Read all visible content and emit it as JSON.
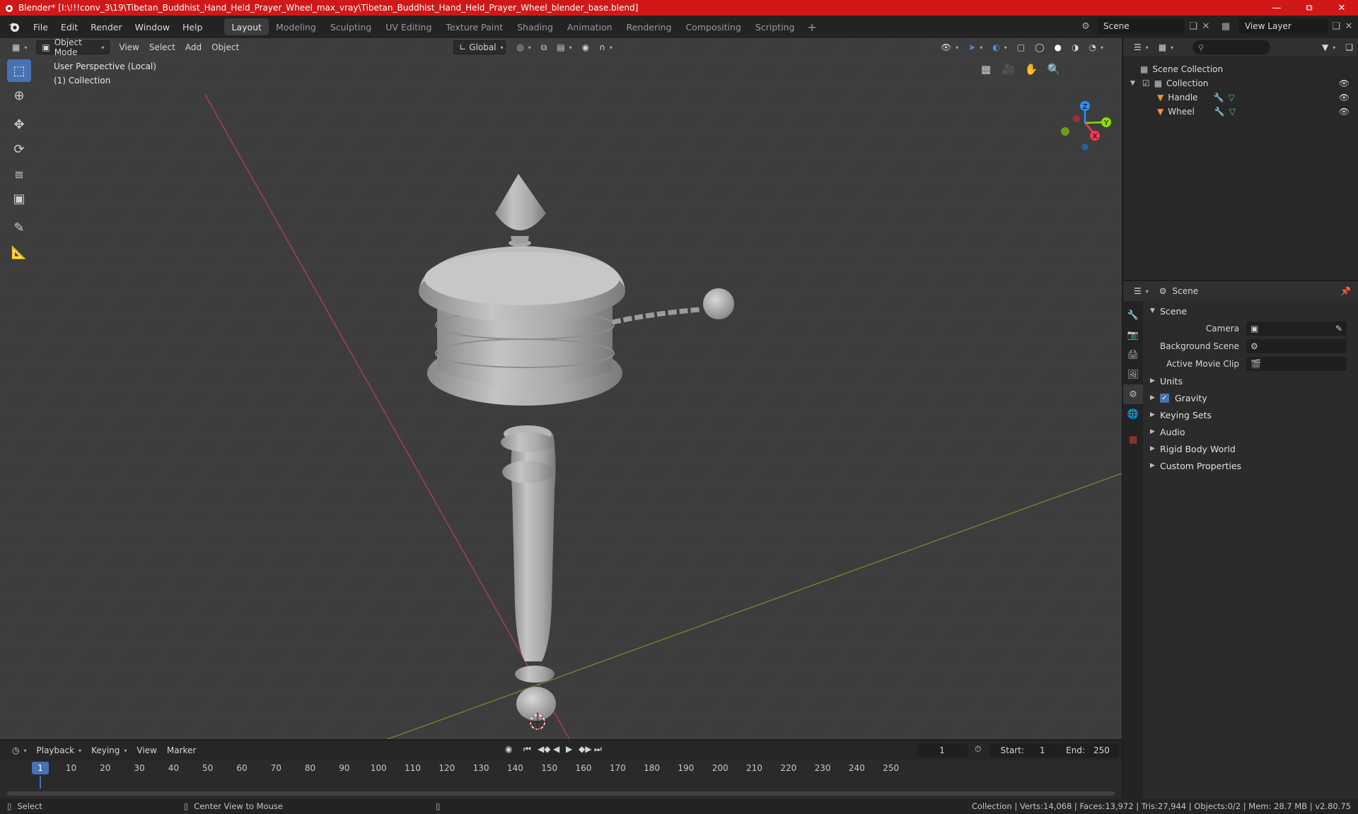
{
  "window": {
    "title": "Blender* [I:\\!!!conv_3\\19\\Tibetan_Buddhist_Hand_Held_Prayer_Wheel_max_vray\\Tibetan_Buddhist_Hand_Held_Prayer_Wheel_blender_base.blend]",
    "controls": {
      "minimize": "—",
      "maximize": "⧉",
      "close": "✕"
    }
  },
  "menu": {
    "items": [
      "File",
      "Edit",
      "Render",
      "Window",
      "Help"
    ],
    "workspaces": [
      "Layout",
      "Modeling",
      "Sculpting",
      "UV Editing",
      "Texture Paint",
      "Shading",
      "Animation",
      "Rendering",
      "Compositing",
      "Scripting"
    ],
    "active_workspace": "Layout",
    "add_workspace": "+",
    "scene": "Scene",
    "view_layer": "View Layer"
  },
  "viewport": {
    "mode": "Object Mode",
    "menus": [
      "View",
      "Select",
      "Add",
      "Object"
    ],
    "transform_orientation": "Global",
    "overlay_line1": "User Perspective (Local)",
    "overlay_line2": "(1) Collection",
    "axis_colors": {
      "x": "#ff3352",
      "y": "#8bdc00",
      "z": "#2890ff"
    },
    "gizmo_labels": {
      "x": "X",
      "y": "Y",
      "z": "Z"
    }
  },
  "tools": [
    "select-box",
    "cursor",
    "move",
    "rotate",
    "scale",
    "transform",
    "annotate",
    "measure"
  ],
  "outliner": {
    "search_placeholder": "",
    "root": "Scene Collection",
    "collection": "Collection",
    "objects": [
      "Handle",
      "Wheel"
    ]
  },
  "properties": {
    "context": "Scene",
    "section": "Scene",
    "camera_label": "Camera",
    "background_scene_label": "Background Scene",
    "active_movie_clip_label": "Active Movie Clip",
    "panels": [
      "Units",
      "Gravity",
      "Keying Sets",
      "Audio",
      "Rigid Body World",
      "Custom Properties"
    ],
    "gravity_checked": true
  },
  "timeline": {
    "menus": [
      "Playback",
      "Keying",
      "View",
      "Marker"
    ],
    "current_frame": "1",
    "start_label": "Start:",
    "start_value": "1",
    "end_label": "End:",
    "end_value": "250",
    "ticks": [
      "1",
      "10",
      "20",
      "30",
      "40",
      "50",
      "60",
      "70",
      "80",
      "90",
      "100",
      "110",
      "120",
      "130",
      "140",
      "150",
      "160",
      "170",
      "180",
      "190",
      "200",
      "210",
      "220",
      "230",
      "240",
      "250"
    ]
  },
  "statusbar": {
    "left_hint": "Select",
    "middle_hint": "Center View to Mouse",
    "stats": "Collection | Verts:14,068 | Faces:13,972 | Tris:27,944 | Objects:0/2 | Mem: 28.7 MB | v2.80.75"
  }
}
